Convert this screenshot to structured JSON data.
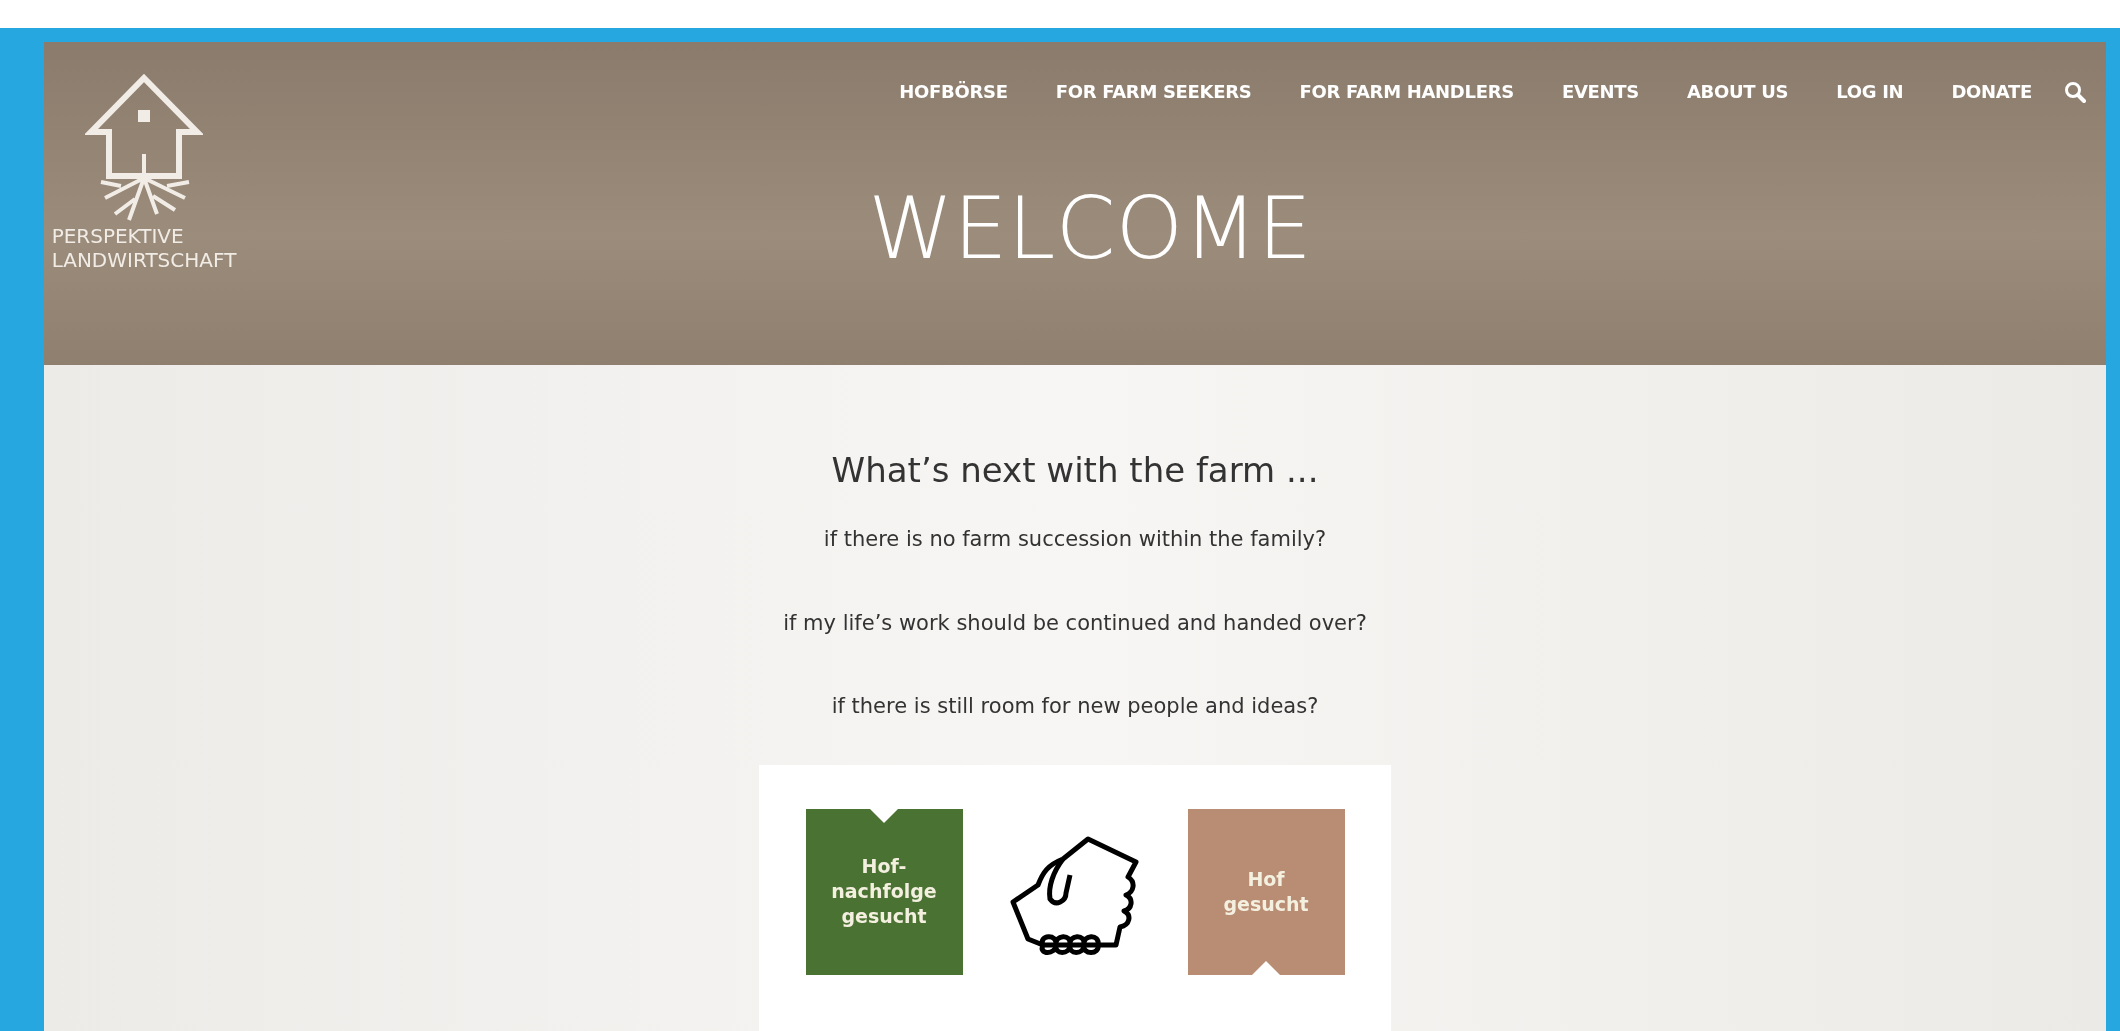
{
  "logo": {
    "lines": [
      "PERSPEKTIVE",
      "LANDWIRTSCHAFT"
    ]
  },
  "nav": [
    {
      "label": "HOFBÖRSE"
    },
    {
      "label": "FOR FARM SEEKERS"
    },
    {
      "label": "FOR FARM HANDLERS"
    },
    {
      "label": "EVENTS"
    },
    {
      "label": "ABOUT US"
    },
    {
      "label": "LOG IN"
    },
    {
      "label": "DONATE"
    }
  ],
  "hero": {
    "title": "WELCOME"
  },
  "intro": {
    "heading": "What’s next with the farm ...",
    "questions": [
      "if there is no farm succession within the family?",
      "if my life’s work should be continued and handed over?",
      "if there is still room for new people and ideas?"
    ]
  },
  "tiles": [
    {
      "lines": [
        "Hof-",
        "nachfolge",
        "gesucht"
      ],
      "color": "#4a7232",
      "kind": "notch-top"
    },
    {
      "lines": [
        "Hof",
        "gesucht"
      ],
      "color": "#b98c74",
      "kind": "notch-bottom"
    }
  ]
}
